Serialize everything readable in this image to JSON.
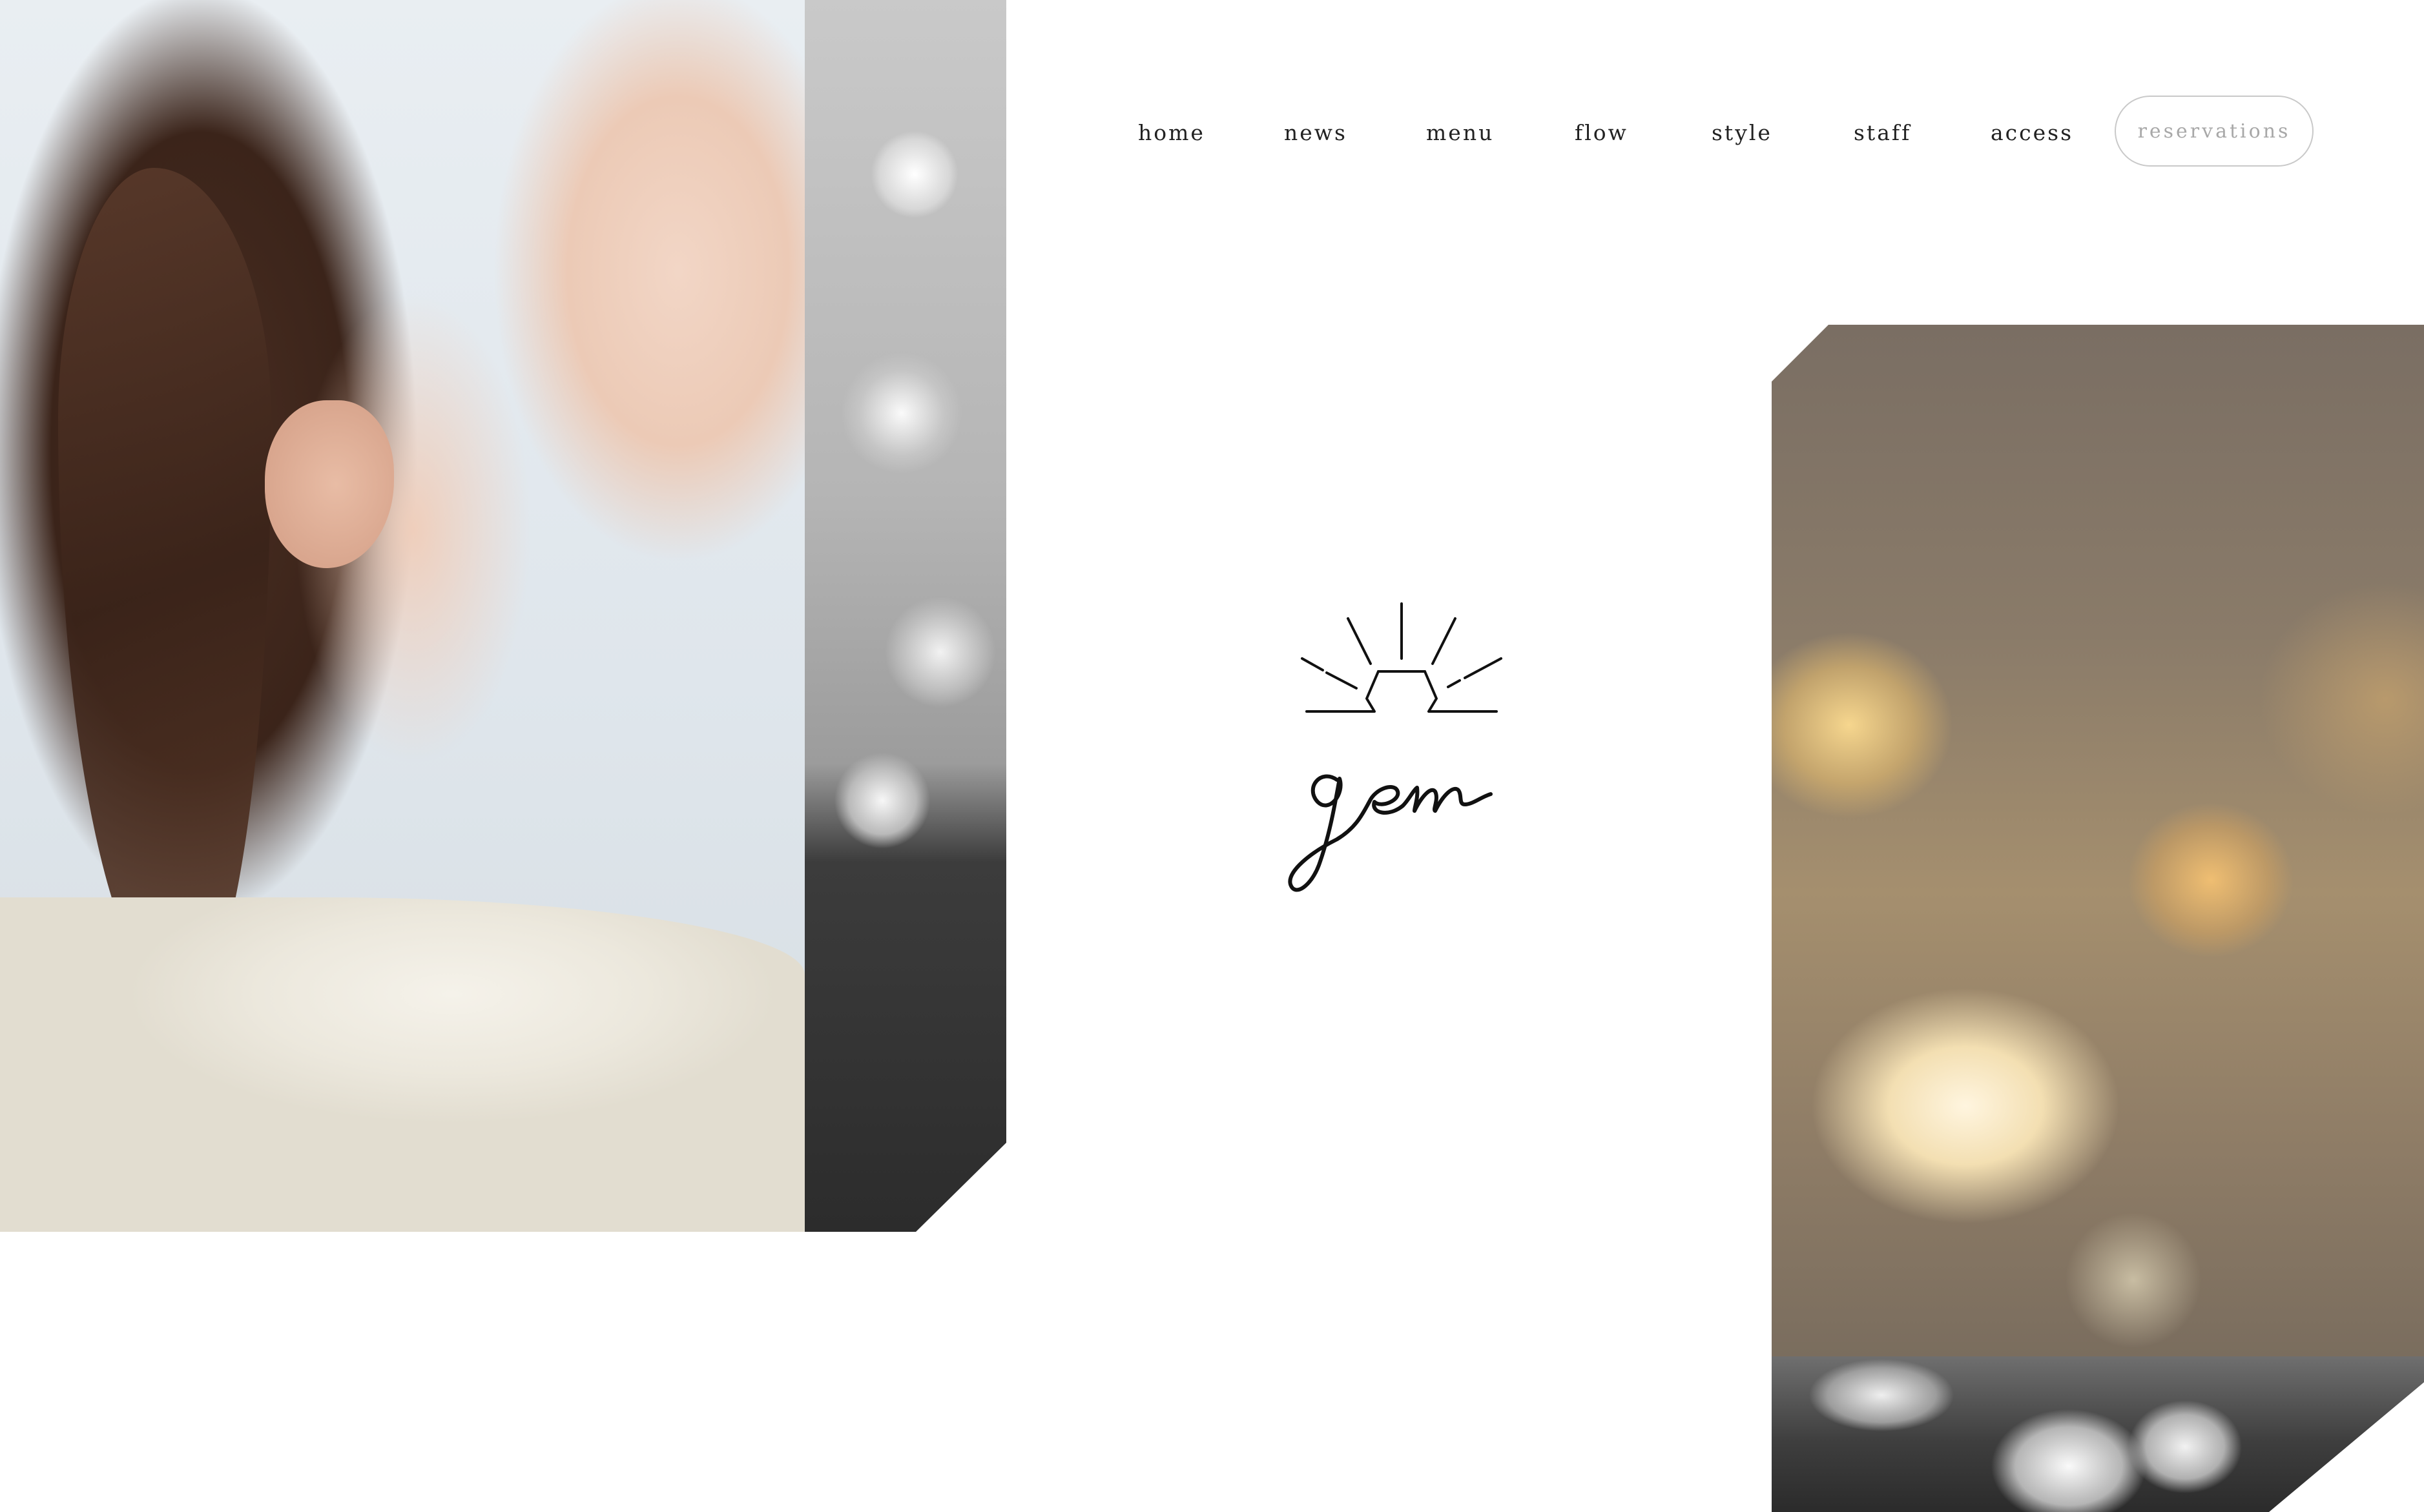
{
  "nav": {
    "items": [
      {
        "label": "home"
      },
      {
        "label": "news"
      },
      {
        "label": "menu"
      },
      {
        "label": "flow"
      },
      {
        "label": "style"
      },
      {
        "label": "staff"
      },
      {
        "label": "access"
      }
    ],
    "reserve_label": "reservations"
  },
  "logo": {
    "wordmark": "gem"
  },
  "colors": {
    "text": "#222222",
    "reserve_border": "#c9c9c9",
    "reserve_text": "#a8a8a8",
    "background": "#ffffff"
  }
}
